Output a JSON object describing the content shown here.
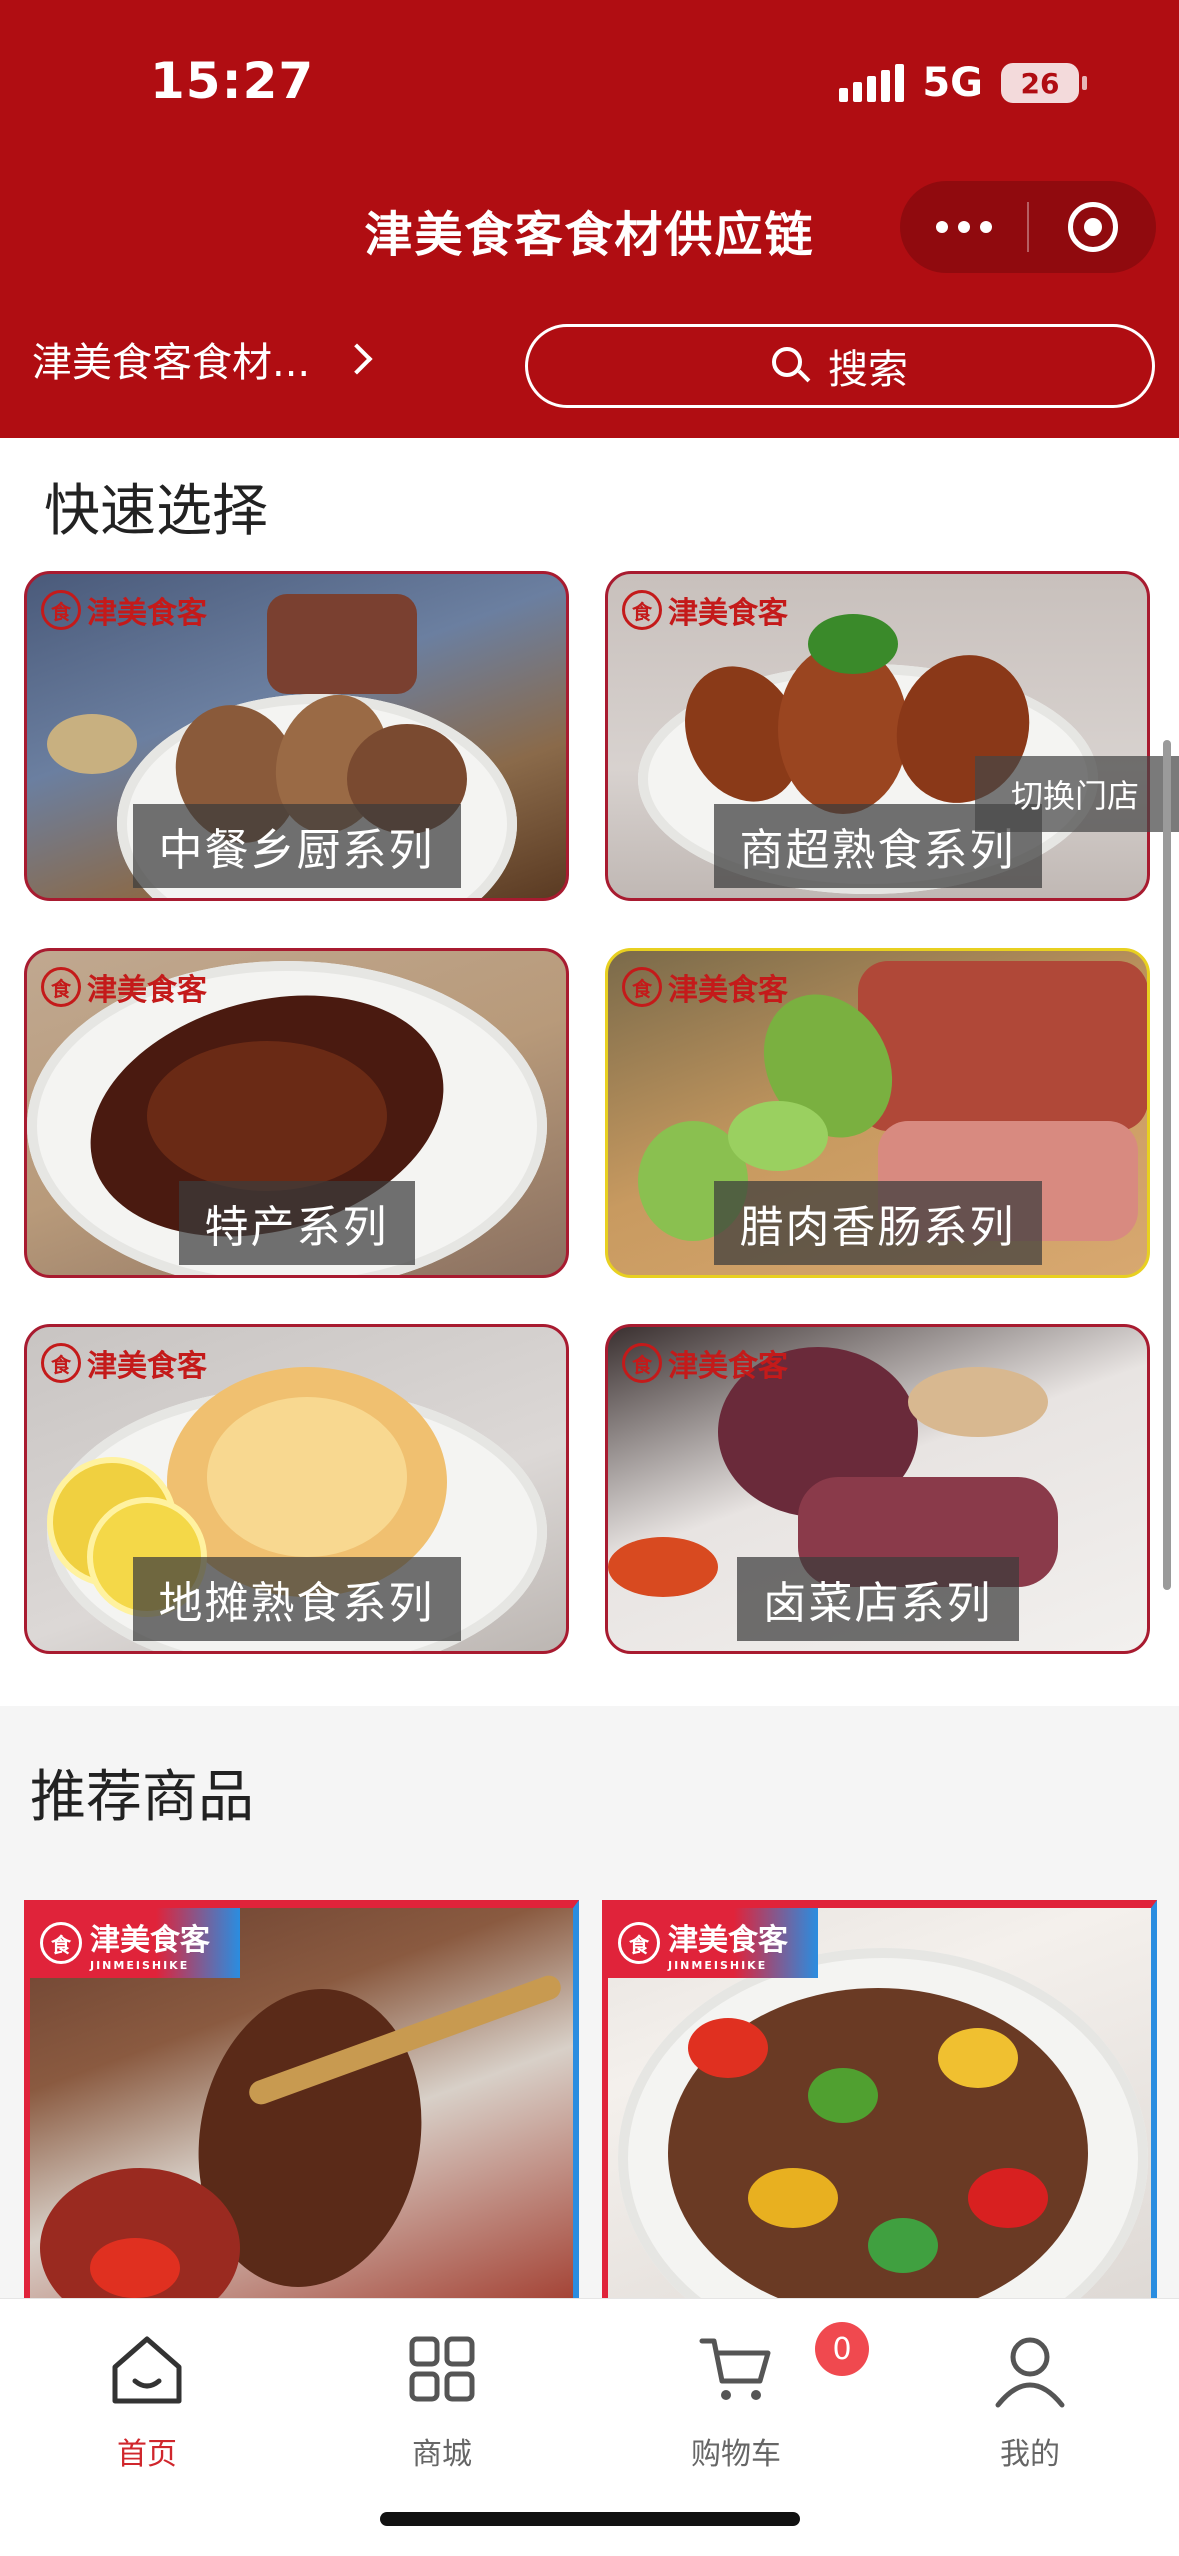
{
  "status_bar": {
    "time": "15:27",
    "network": "5G",
    "battery": "26"
  },
  "nav": {
    "title": "津美食客食材供应链"
  },
  "store": {
    "name": "津美食客食材..."
  },
  "search": {
    "label": "搜索"
  },
  "quick_select": {
    "title": "快速选择",
    "items": [
      {
        "label": "中餐乡厨系列"
      },
      {
        "label": "商超熟食系列"
      },
      {
        "label": "特产系列"
      },
      {
        "label": "腊肉香肠系列"
      },
      {
        "label": "地摊熟食系列"
      },
      {
        "label": "卤菜店系列"
      }
    ],
    "switch_store": "切换门店"
  },
  "brand": {
    "name": "津美食客",
    "latin": "JINMEISHIKE"
  },
  "recommended": {
    "title": "推荐商品"
  },
  "tabbar": {
    "items": [
      {
        "label": "首页",
        "icon": "home-icon",
        "active": true
      },
      {
        "label": "商城",
        "icon": "grid-icon"
      },
      {
        "label": "购物车",
        "icon": "cart-icon"
      },
      {
        "label": "我的",
        "icon": "user-icon"
      }
    ],
    "cart_count": "0"
  },
  "colors": {
    "primary": "#b00d12",
    "active_tab": "#d0262c",
    "badge": "#f0494f"
  }
}
